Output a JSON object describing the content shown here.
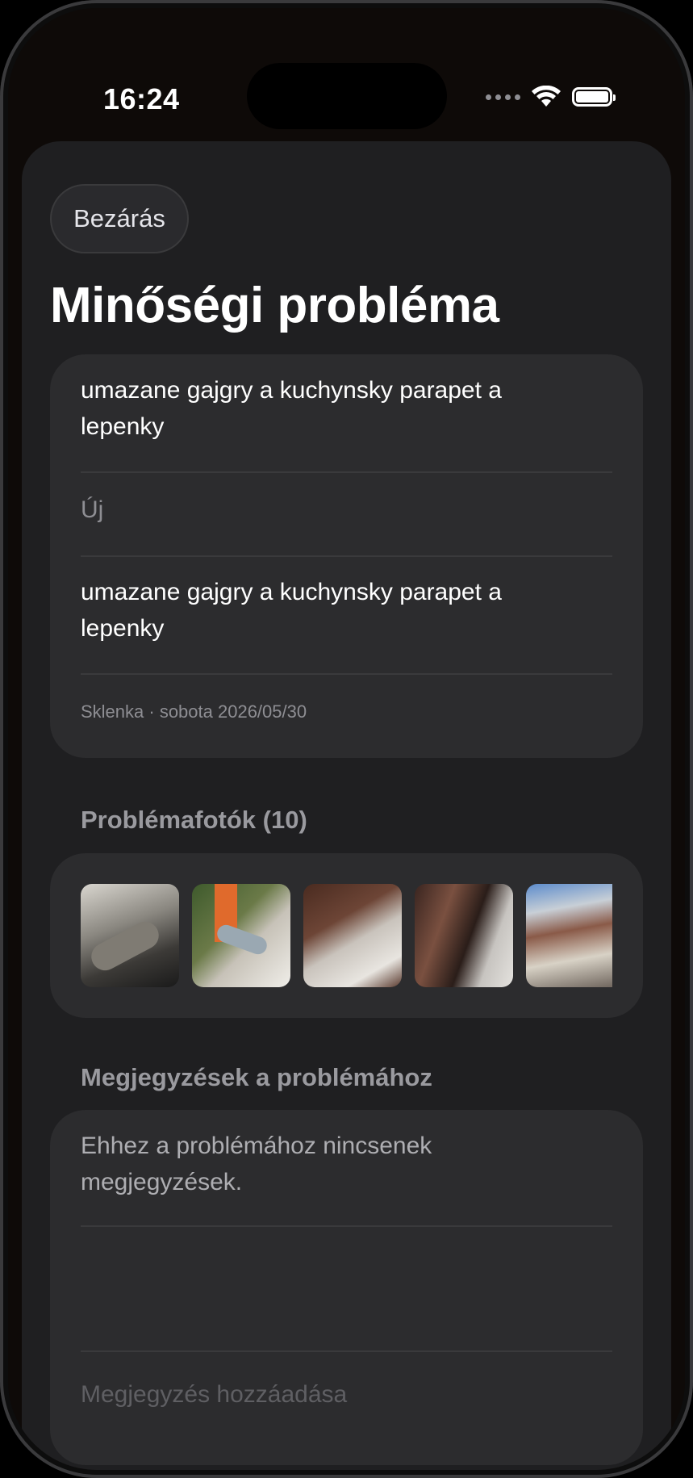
{
  "status_bar": {
    "time": "16:24"
  },
  "header": {
    "close_label": "Bezárás",
    "title": "Minőségi probléma"
  },
  "issue": {
    "title": "umazane gajgry a kuchynsky parapet a lepenky",
    "status": "Új",
    "description": "umazane gajgry a kuchynsky parapet a lepenky",
    "meta": "Sklenka · sobota 2026/05/30"
  },
  "photos": {
    "section_label": "Problémafotók (10)",
    "items": [
      {
        "name": "photo-1"
      },
      {
        "name": "photo-2"
      },
      {
        "name": "photo-3"
      },
      {
        "name": "photo-4"
      },
      {
        "name": "photo-5"
      }
    ]
  },
  "notes": {
    "section_label": "Megjegyzések a problémához",
    "empty_text": "Ehhez a problémához nincsenek megjegyzések.",
    "input_placeholder": "Megjegyzés hozzáadása"
  }
}
